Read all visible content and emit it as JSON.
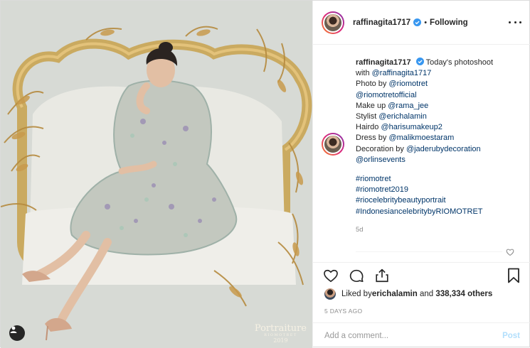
{
  "photo": {
    "watermark_main": "Portraiture",
    "watermark_sub": "RIOMOTRET",
    "watermark_year": "2019"
  },
  "header": {
    "username": "raffinagita1717",
    "separator": "•",
    "follow_status": "Following"
  },
  "caption": {
    "username": "raffinagita1717",
    "text_first": "Today's photoshoot",
    "line_with_prefix": "with ",
    "line_with_mention": "@raffinagita1717",
    "photo_prefix": "Photo by ",
    "photo_mention": "@riomotret",
    "photo_mention_2": "@riomotretofficial",
    "makeup_prefix": "Make up ",
    "makeup_mention": "@rama_jee",
    "stylist_prefix": "Stylist ",
    "stylist_mention": "@erichalamin",
    "hairdo_prefix": "Hairdo ",
    "hairdo_mention": "@harisumakeup2",
    "dress_prefix": "Dress by ",
    "dress_mention": "@malikmoestaram",
    "decoration_prefix": "Decoration by ",
    "decoration_mention": "@jaderubydecoration",
    "decoration_mention_2": "@orlinsevents",
    "hashtags": [
      "#riomotret",
      "#riomotret2019",
      "#riocelebritybeautyportrait",
      "#IndonesiancelebritybyRIOMOTRET"
    ],
    "age": "5d"
  },
  "likes": {
    "prefix": "Liked by ",
    "user": "erichalamin",
    "middle": " and ",
    "count": "338,334 others"
  },
  "timestamp": "5 DAYS AGO",
  "comment_box": {
    "placeholder": "Add a comment...",
    "post_label": "Post"
  },
  "icons": {
    "verified": "verified-badge-icon",
    "more": "more-options-icon",
    "heart": "heart-icon",
    "comment": "comment-icon",
    "share": "share-icon",
    "bookmark": "bookmark-icon",
    "user_tags": "user-tag-icon"
  },
  "colors": {
    "link": "#003569",
    "verified": "#3897f0",
    "post_disabled": "#b2dffc",
    "muted": "#8e8e8e"
  }
}
